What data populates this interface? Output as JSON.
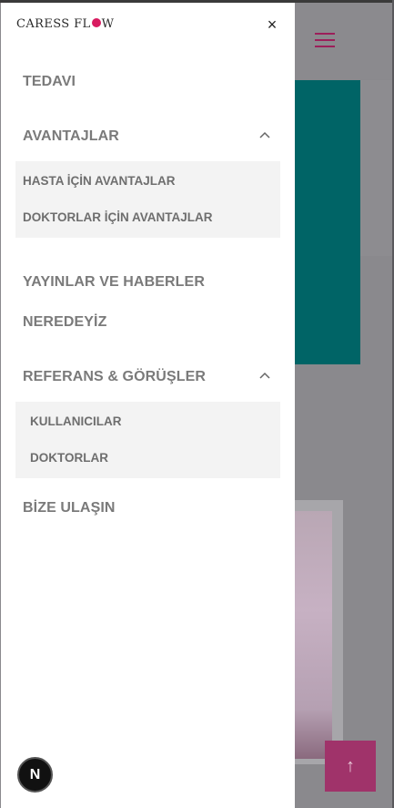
{
  "brand": {
    "logo_text_before": "CARESS FL",
    "logo_text_after": "W"
  },
  "drawer": {
    "close_glyph": "×",
    "menu": {
      "tedavi": "TEDAVI",
      "avantajlar": "AVANTAJLAR",
      "avantajlar_sub": [
        "HASTA İÇİN AVANTAJLAR",
        "DOKTORLAR İÇİN AVANTAJLAR"
      ],
      "yayinlar": "YAYINLAR VE HABERLER",
      "neredeyiz": "NEREDEYİZ",
      "referans": "REFERANS & GÖRÜŞLER",
      "referans_sub": [
        "KULLANICILAR",
        "DOKTORLAR"
      ],
      "bize_ulasin": "BİZE ULAŞIN"
    }
  },
  "floating": {
    "badge_letter": "N",
    "scroll_top_glyph": "↑"
  },
  "colors": {
    "accent": "#9c1f5a",
    "teal": "#006466",
    "menu_text": "#7a7a7a"
  },
  "icons": [
    "hamburger-icon",
    "close-icon",
    "chevron-up-icon",
    "arrow-up-icon"
  ]
}
